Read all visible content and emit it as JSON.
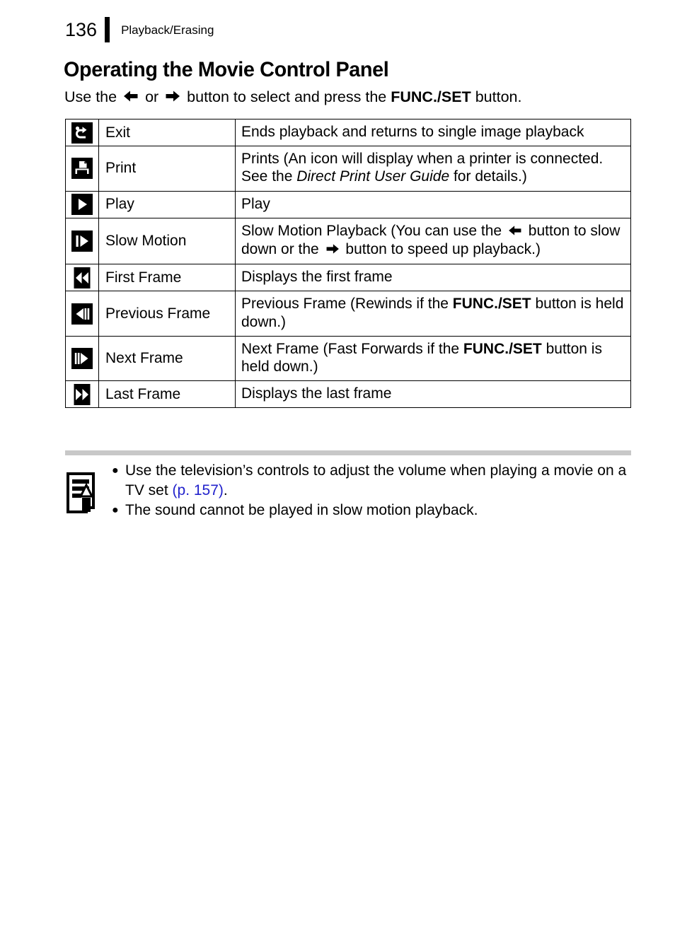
{
  "header": {
    "page_number": "136",
    "chapter": "Playback/Erasing"
  },
  "section": {
    "title": "Operating the Movie Control Panel",
    "lead_pre": "Use the",
    "lead_or": "or",
    "lead_mid": "button to select and press the",
    "lead_bold": "FUNC./SET",
    "lead_post": "button.",
    "left_arrow_icon": "left-arrow-icon",
    "right_arrow_icon": "right-arrow-icon"
  },
  "control_table": {
    "rows": [
      {
        "icon": "exit-return-icon",
        "label": "Exit",
        "desc_pre": "Ends playback and returns to single image playback",
        "desc_post": ""
      },
      {
        "icon": "print-icon",
        "label": "Print",
        "desc_pre": "Prints (An icon will display when a printer is connected. See the ",
        "desc_italic": "Direct Print User Guide",
        "desc_post": " for details.)"
      },
      {
        "icon": "play-icon",
        "label": "Play",
        "desc_pre": "Play",
        "desc_post": ""
      },
      {
        "icon": "slow-motion-icon",
        "label": "Slow Motion",
        "desc_pre": "Slow Motion Playback (You can use the ",
        "desc_mid": " button to slow down or the ",
        "desc_post": " button to speed up playback.)"
      },
      {
        "icon": "first-frame-icon",
        "label": "First Frame",
        "desc_pre": "Displays the first frame",
        "desc_post": ""
      },
      {
        "icon": "previous-frame-icon",
        "label": "Previous Frame",
        "desc_pre": "Previous Frame (Rewinds if the ",
        "desc_bold": "FUNC./SET",
        "desc_post": " button is held down.)"
      },
      {
        "icon": "next-frame-icon",
        "label": "Next Frame",
        "desc_pre": "Next Frame (Fast Forwards if the ",
        "desc_bold": "FUNC./SET",
        "desc_post": " button is held down.)"
      },
      {
        "icon": "last-frame-icon",
        "label": "Last Frame",
        "desc_pre": "Displays the last frame",
        "desc_post": ""
      }
    ]
  },
  "note": {
    "icon": "memo-pencil-icon",
    "bullet": "●",
    "items": [
      {
        "text_pre": "Use the television’s controls to adjust the volume when playing a movie on a TV set ",
        "link": "(p. 157)",
        "text_post": "."
      },
      {
        "text_pre": "The sound cannot be played in slow motion playback.",
        "link": "",
        "text_post": ""
      }
    ]
  },
  "colors": {
    "link": "#2222cc",
    "rule_grey": "#c8c8c8",
    "ink": "#000000"
  }
}
